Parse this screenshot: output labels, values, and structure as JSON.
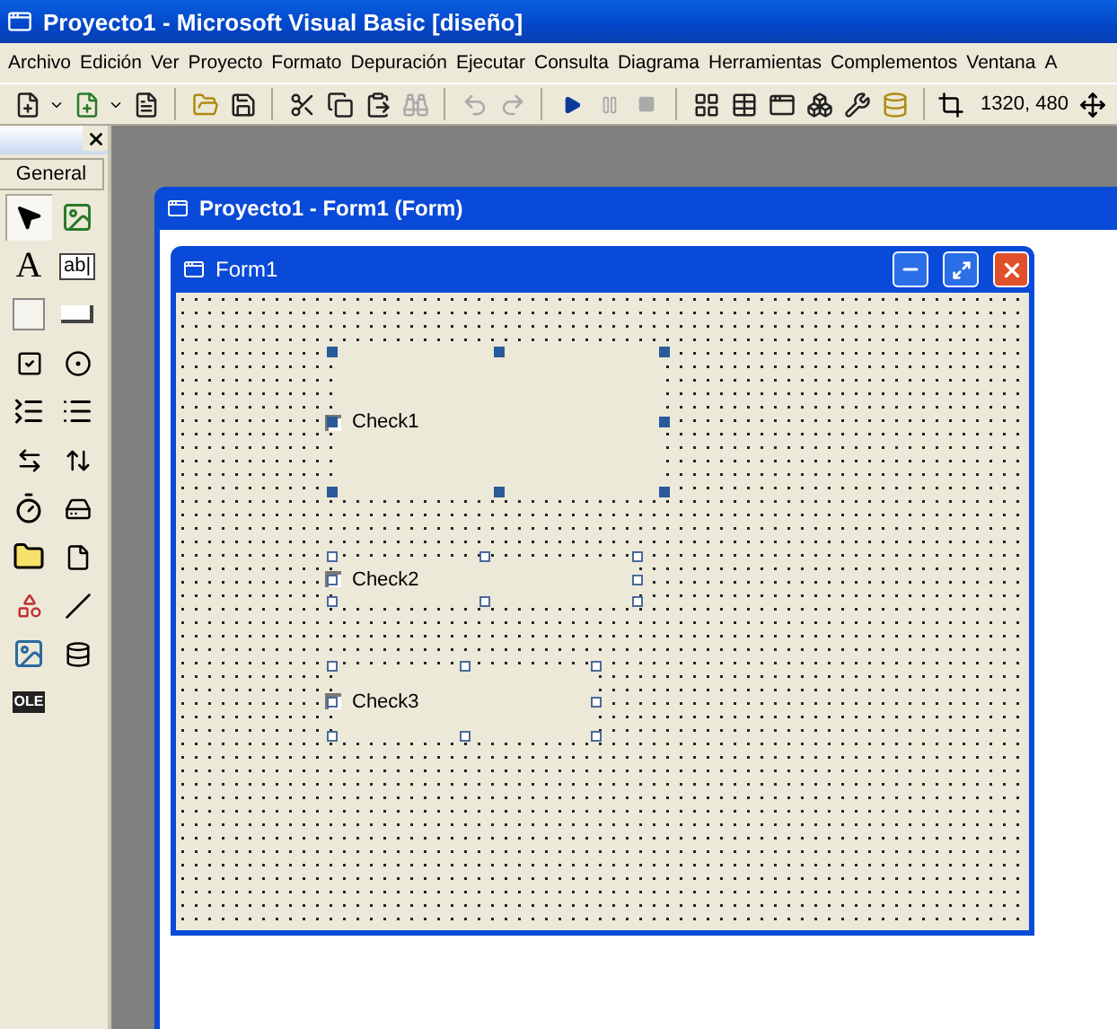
{
  "window": {
    "title": "Proyecto1 - Microsoft Visual Basic [diseño]"
  },
  "menu": [
    "Archivo",
    "Edición",
    "Ver",
    "Proyecto",
    "Formato",
    "Depuración",
    "Ejecutar",
    "Consulta",
    "Diagrama",
    "Herramientas",
    "Complementos",
    "Ventana",
    "A"
  ],
  "toolbar": {
    "coordinates": "1320, 480"
  },
  "toolbox": {
    "tab": "General",
    "tools": [
      {
        "kind": "pointer",
        "selected": true
      },
      {
        "kind": "picture",
        "selected": false
      },
      {
        "kind": "label",
        "glyph": "A",
        "selected": false
      },
      {
        "kind": "textbox",
        "glyph": "ab|",
        "selected": false
      },
      {
        "kind": "frame",
        "selected": false
      },
      {
        "kind": "button",
        "selected": false
      },
      {
        "kind": "checkbox",
        "selected": false
      },
      {
        "kind": "option",
        "selected": false
      },
      {
        "kind": "combo",
        "selected": false
      },
      {
        "kind": "list",
        "selected": false
      },
      {
        "kind": "hscroll",
        "selected": false
      },
      {
        "kind": "vscroll",
        "selected": false
      },
      {
        "kind": "timer",
        "selected": false
      },
      {
        "kind": "drive",
        "selected": false
      },
      {
        "kind": "dir",
        "selected": false
      },
      {
        "kind": "file",
        "selected": false
      },
      {
        "kind": "shape",
        "selected": false
      },
      {
        "kind": "line",
        "selected": false
      },
      {
        "kind": "image",
        "selected": false
      },
      {
        "kind": "data",
        "selected": false
      },
      {
        "kind": "ole",
        "glyph": "OLE",
        "selected": false
      }
    ]
  },
  "designer": {
    "title": "Proyecto1 - Form1 (Form)"
  },
  "form": {
    "title": "Form1",
    "controls": [
      {
        "caption": "Check1",
        "active": true
      },
      {
        "caption": "Check2",
        "active": false
      },
      {
        "caption": "Check3",
        "active": false
      }
    ]
  }
}
